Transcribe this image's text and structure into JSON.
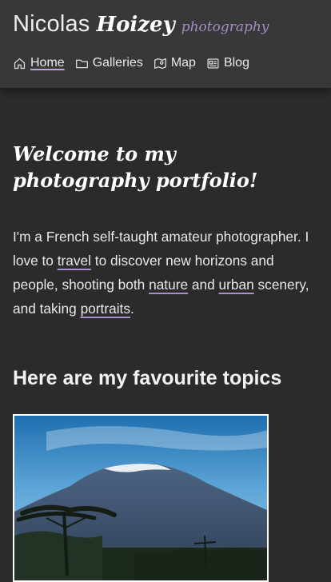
{
  "brand": {
    "first": "Nicolas",
    "last": "Hoizey",
    "tagline": "photography"
  },
  "nav": {
    "items": [
      {
        "label": "Home",
        "icon": "home-icon",
        "active": true
      },
      {
        "label": "Galleries",
        "icon": "folder-icon",
        "active": false
      },
      {
        "label": "Map",
        "icon": "map-icon",
        "active": false
      },
      {
        "label": "Blog",
        "icon": "blog-icon",
        "active": false
      }
    ]
  },
  "welcome": {
    "heading": "Welcome to my photography portfolio!"
  },
  "intro": {
    "part1": "I'm a French self-taught amateur photographer. I love to ",
    "link_travel": "travel",
    "part2": " to discover new horizons and people, shooting both ",
    "link_nature": "nature",
    "part3": " and ",
    "link_urban": "urban",
    "part4": " scenery, and taking ",
    "link_portraits": "portraits",
    "part5": "."
  },
  "topics": {
    "heading": "Here are my favourite topics"
  },
  "colors": {
    "background": "#2b2b2b",
    "header": "#383838",
    "accent": "#a58cc6"
  }
}
